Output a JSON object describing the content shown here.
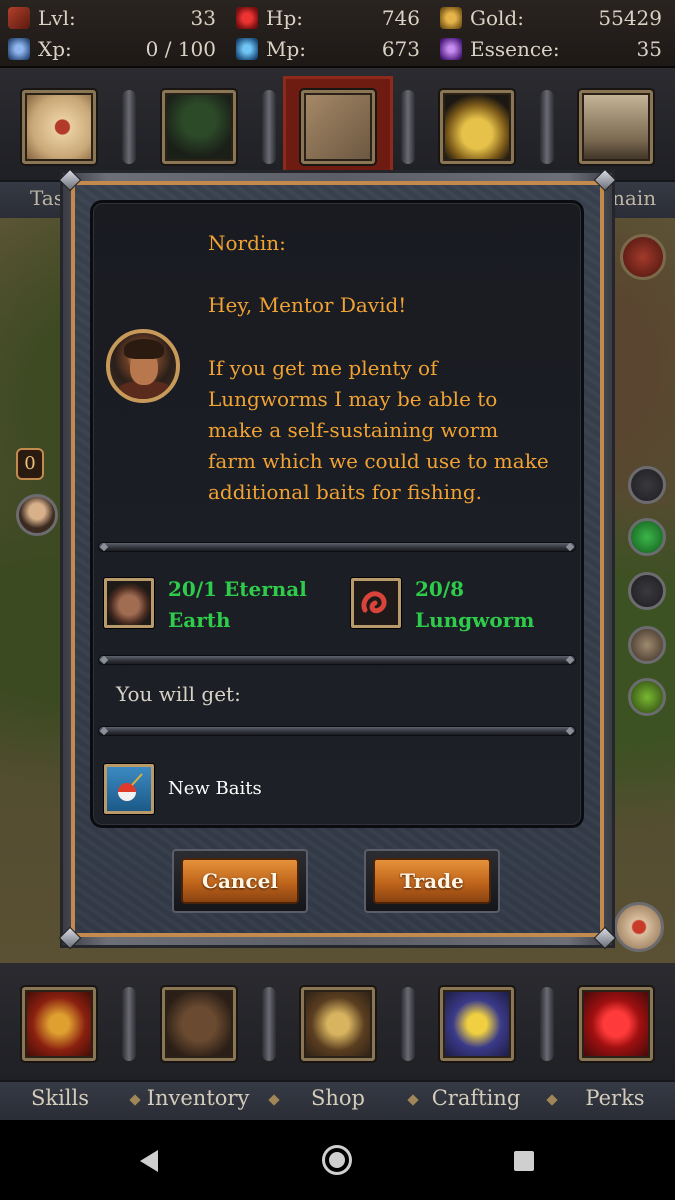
{
  "stats": {
    "level_label": "Lvl:",
    "level_value": "33",
    "hp_label": "Hp:",
    "hp_value": "746",
    "gold_label": "Gold:",
    "gold_value": "55429",
    "xp_label": "Xp:",
    "xp_value": "0 / 100",
    "mp_label": "Mp:",
    "mp_value": "673",
    "essence_label": "Essence:",
    "essence_value": "35"
  },
  "top_nav": {
    "tabs_partial": [
      "Tas",
      "nain"
    ],
    "icons": [
      "scroll-seal-icon",
      "wagon-icon",
      "map-icon",
      "gold-pile-icon",
      "castle-icon"
    ]
  },
  "dialog": {
    "speaker": "Nordin:",
    "greeting": "Hey, Mentor David!",
    "message_lines": [
      "If you get me plenty of",
      "Lungworms I may be able to",
      "make a self-sustaining worm",
      "farm which we could use to make",
      "additional baits for fishing."
    ],
    "requirements": [
      {
        "line1": "20/1 Eternal",
        "line2": "Earth",
        "icon": "eternal-earth-icon"
      },
      {
        "line1": "20/8",
        "line2": "Lungworm",
        "icon": "lungworm-icon"
      }
    ],
    "reward_label": "You will get:",
    "reward": {
      "name": "New Baits",
      "icon": "fishing-bait-icon"
    },
    "cancel_label": "Cancel",
    "trade_label": "Trade"
  },
  "map_side": {
    "badge_value": "0"
  },
  "bottom_nav": {
    "tabs": [
      "Skills",
      "Inventory",
      "Shop",
      "Crafting",
      "Perks"
    ],
    "icons": [
      "crossed-swords-icon",
      "backpack-icon",
      "scales-icon",
      "hourglass-icon",
      "heart-icon"
    ]
  },
  "colors": {
    "npc_text": "#f0a233",
    "requirement_text": "#2ecc4a",
    "button": "#c0651c",
    "frame_accent": "#c28a4c"
  }
}
